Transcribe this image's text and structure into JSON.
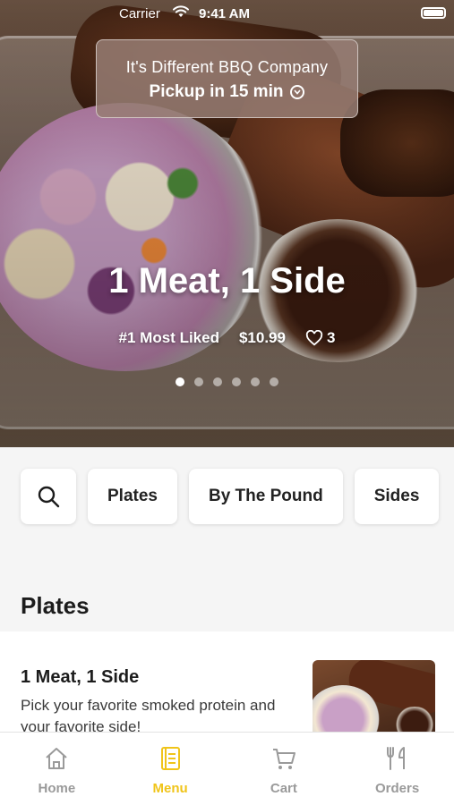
{
  "status_bar": {
    "carrier": "Carrier",
    "time": "9:41 AM"
  },
  "store": {
    "name": "It's Different BBQ Company",
    "pickup": "Pickup in 15 min"
  },
  "hero": {
    "title": "1 Meat, 1 Side",
    "badge": "#1 Most Liked",
    "price": "$10.99",
    "likes": "3",
    "carousel_pages": 6,
    "carousel_active": 1
  },
  "categories": {
    "search_icon": "search-icon",
    "items": [
      "Plates",
      "By The Pound",
      "Sides"
    ]
  },
  "section": {
    "title": "Plates"
  },
  "menu_item": {
    "name": "1 Meat, 1 Side",
    "description": "Pick your favorite smoked protein and your favorite side!"
  },
  "tabbar": {
    "active": "Menu",
    "accent_color": "#f0c419",
    "tabs": [
      {
        "label": "Home",
        "icon": "home-icon"
      },
      {
        "label": "Menu",
        "icon": "menu-icon"
      },
      {
        "label": "Cart",
        "icon": "cart-icon"
      },
      {
        "label": "Orders",
        "icon": "orders-icon"
      }
    ]
  }
}
